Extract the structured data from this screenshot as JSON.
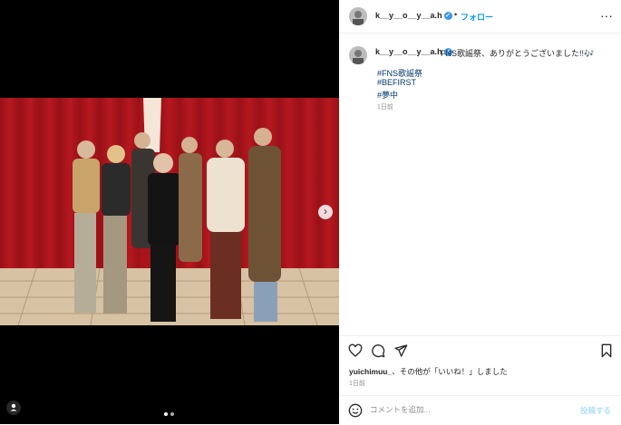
{
  "post": {
    "username": "k__y__o__y__a.h",
    "follow_label": "フォロー",
    "caption": "FNS歌謡祭、ありがとうございました!!🎶",
    "hashtags": [
      "#FNS歌謡祭",
      "#BEFIRST",
      "#夢中"
    ],
    "caption_time": "1日前"
  },
  "likes": {
    "liker": "yuichimuu_",
    "text": "、その他が「いいね！」しました",
    "time": "1日前"
  },
  "comment": {
    "placeholder": "コメントを追加...",
    "post_label": "投稿する"
  },
  "carousel": {
    "slide_count": 2,
    "current_slide": 1
  },
  "colors": {
    "link": "#0095f6",
    "hashtag": "#00376b",
    "verified": "#3897f0",
    "curtain": "#b0161e"
  }
}
